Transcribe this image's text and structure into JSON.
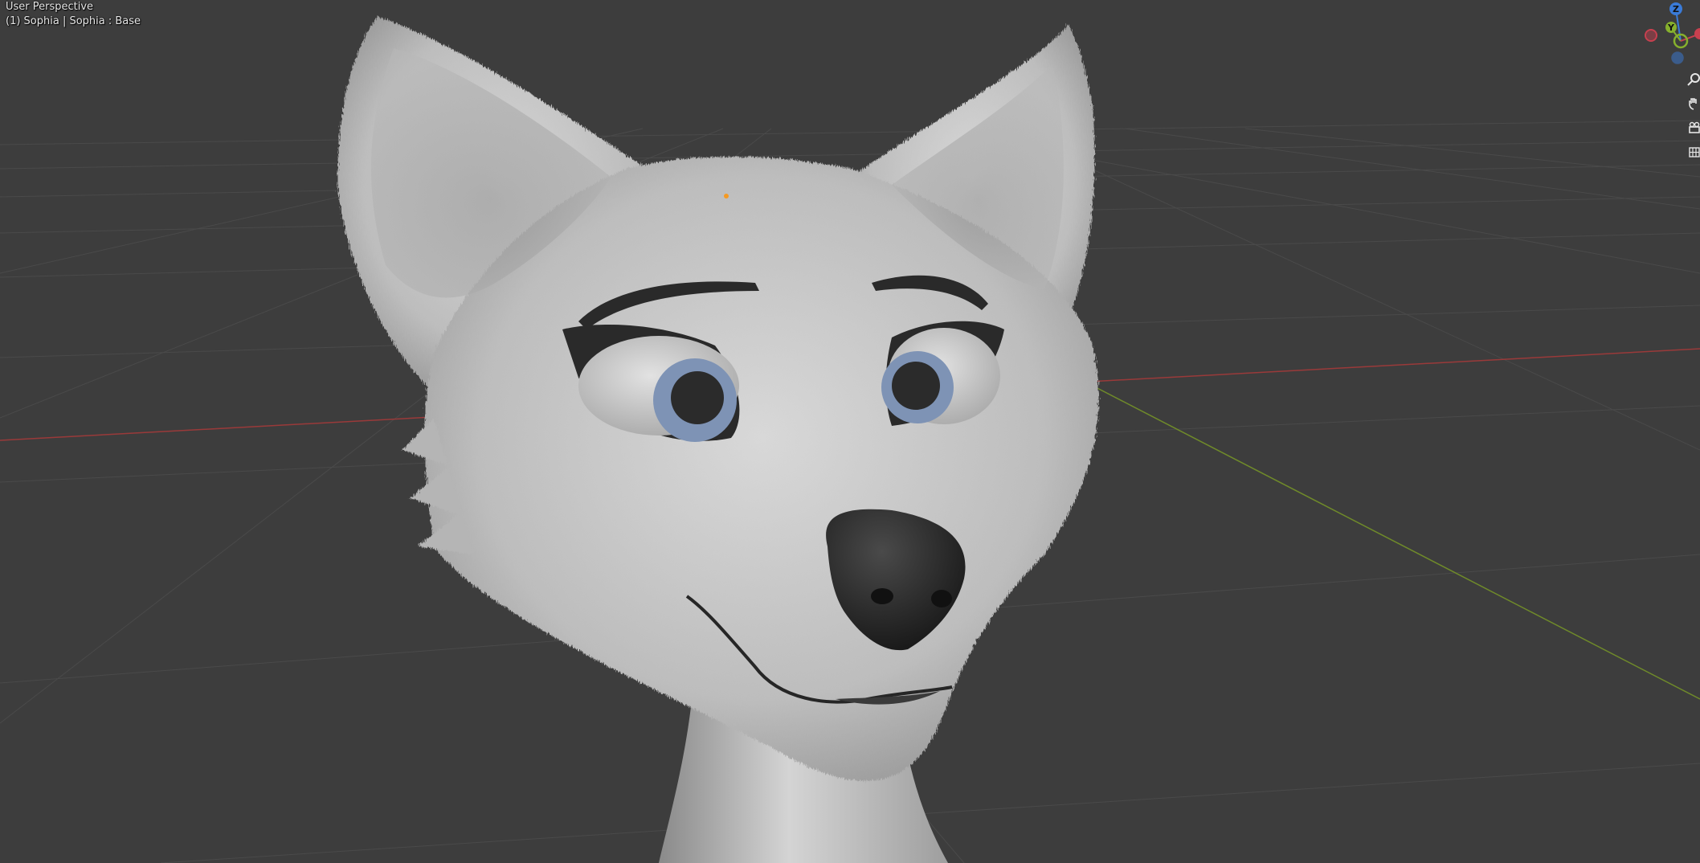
{
  "viewport": {
    "view_mode": "User Perspective",
    "active_object": "(1) Sophia | Sophia : Base"
  },
  "gizmo": {
    "z_label": "Z",
    "y_label": "Y",
    "colors": {
      "x": "#c8404f",
      "y": "#86b02d",
      "z": "#3a7bd8"
    }
  },
  "nav_tools": [
    {
      "name": "zoom-icon"
    },
    {
      "name": "pan-hand-icon"
    },
    {
      "name": "camera-icon"
    },
    {
      "name": "grid-ortho-icon"
    }
  ],
  "colors": {
    "background": "#3d3d3d",
    "grid": "#4a4a4a",
    "x_axis": "#9a3a3a",
    "y_axis": "#6f8a2a"
  }
}
